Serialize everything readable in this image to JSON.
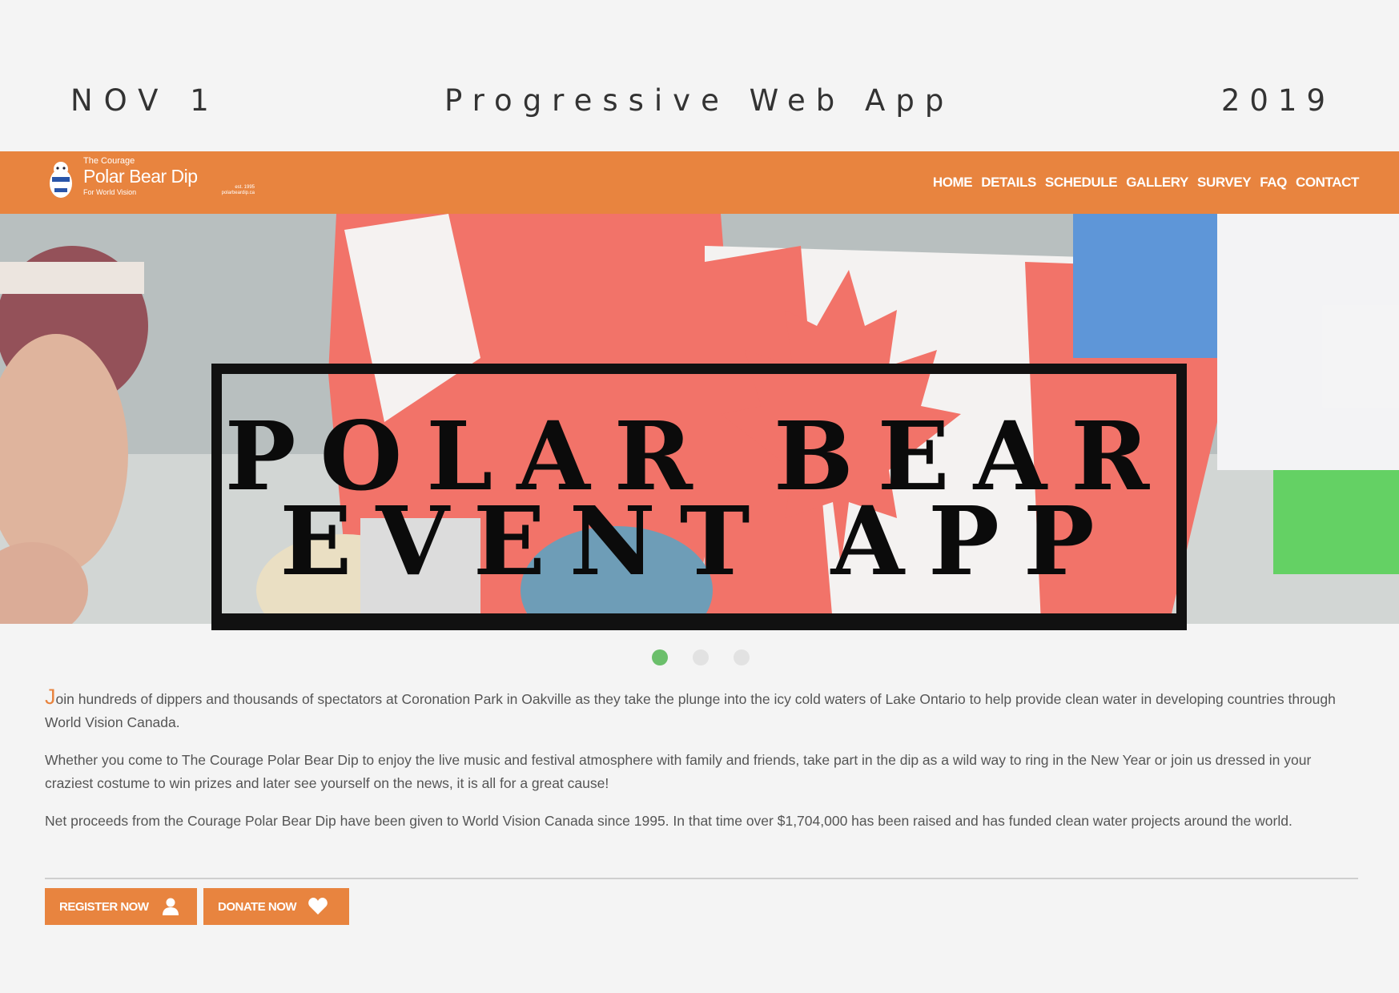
{
  "poster": {
    "date": "NOV 1",
    "title": "Progressive Web App",
    "year": "2019"
  },
  "navbar": {
    "logo": {
      "small": "The Courage",
      "main": "Polar Bear Dip",
      "sub": "For World Vision",
      "est": "est. 1995 polarbeardip.ca"
    },
    "links": [
      "HOME",
      "DETAILS",
      "SCHEDULE",
      "GALLERY",
      "SURVEY",
      "FAQ",
      "CONTACT"
    ],
    "accent": "#e8843f"
  },
  "hero": {
    "title_line1": "POLAR BEAR",
    "title_line2": "EVENT APP"
  },
  "carousel": {
    "active_index": 0,
    "count": 3,
    "active_color": "#6bbf6b"
  },
  "content": {
    "dropcap": "J",
    "p1": "oin hundreds of dippers and thousands of spectators at Coronation Park in Oakville as they take the plunge into the icy cold waters of Lake Ontario to help provide clean water in developing countries through World Vision Canada.",
    "p2": "Whether you come to The Courage Polar Bear Dip to enjoy the live music and festival atmosphere with family and friends, take part in the dip as a wild way to ring in the New Year or join us dressed in your craziest costume to win prizes and later see yourself on the news, it is all for a great cause!",
    "p3": "Net proceeds from the Courage Polar Bear Dip have been given to World Vision Canada since 1995. In that time over $1,704,000 has been raised and has funded clean water projects around the world."
  },
  "buttons": {
    "register": "REGISTER NOW",
    "register_icon": "user-icon",
    "donate": "DONATE NOW",
    "donate_icon": "heart-icon"
  }
}
